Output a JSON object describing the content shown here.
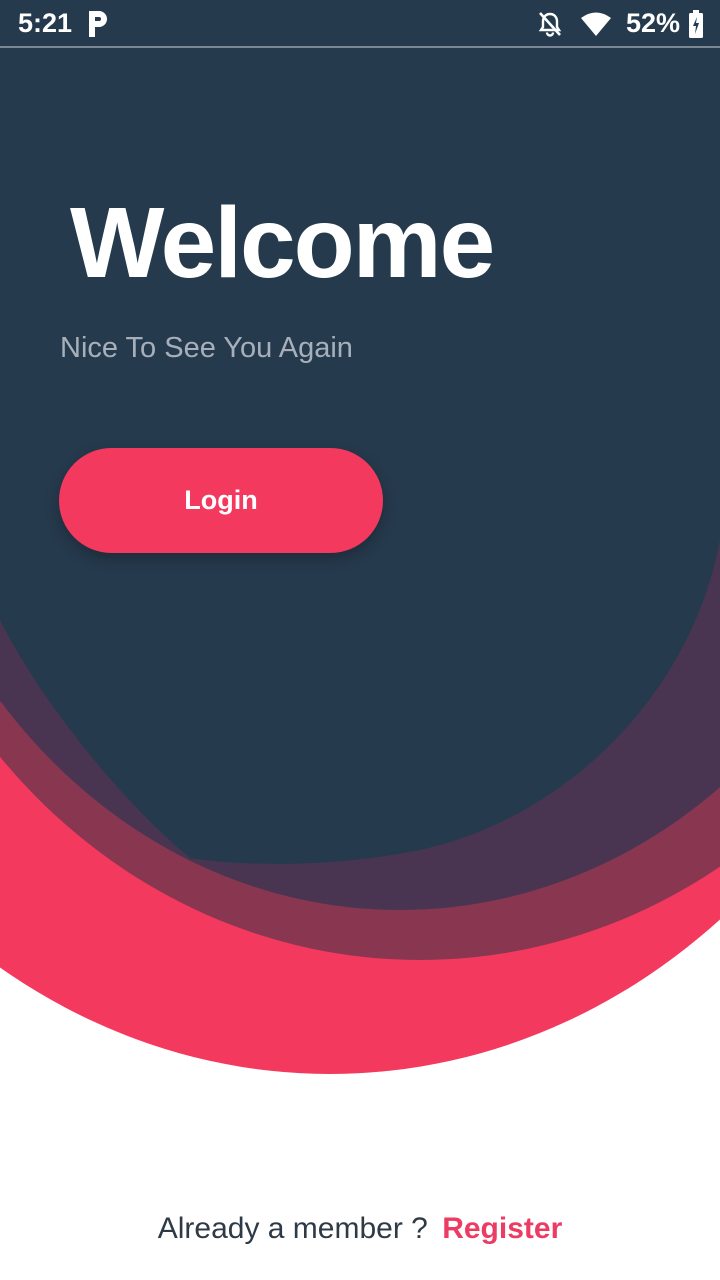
{
  "status_bar": {
    "time": "5:21",
    "battery": "52%"
  },
  "welcome": {
    "title": "Welcome",
    "subtitle": "Nice To See You Again"
  },
  "actions": {
    "login_label": "Login"
  },
  "footer": {
    "prompt": "Already a member ?",
    "register_label": "Register"
  },
  "colors": {
    "dark_navy": "#263a4d",
    "accent_pink": "#f4395f",
    "wine": "#8d3a55"
  },
  "icons": [
    "parking-icon",
    "bell-off-icon",
    "wifi-icon",
    "battery-icon"
  ]
}
